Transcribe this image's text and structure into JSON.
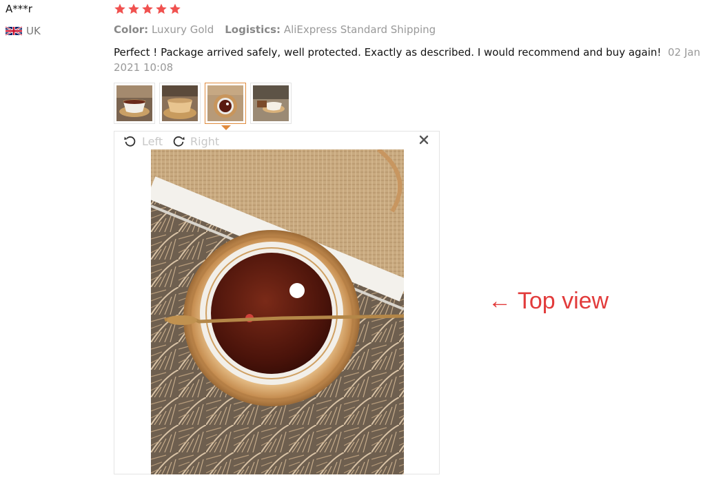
{
  "user": {
    "name": "A***r",
    "country": "UK",
    "flag_icon": "uk-flag-icon"
  },
  "review": {
    "rating": 5,
    "max_rating": 5,
    "star_color": "#f0514f",
    "color_label": "Color:",
    "color_value": "Luxury Gold",
    "logistics_label": "Logistics:",
    "logistics_value": "AliExpress Standard Shipping",
    "text": "Perfect ! Package arrived safely, well protected. Exactly as described. I would recommend and buy again!",
    "date": "02 Jan 2021 10:08"
  },
  "gallery": {
    "thumbnail_count": 4,
    "active_index": 2,
    "accent_color": "#e08a3c"
  },
  "viewer": {
    "rotate_left_label": "Left",
    "rotate_right_label": "Right",
    "close_icon": "close-icon"
  },
  "annotation": {
    "text": "← Top view",
    "color": "#e23b3b"
  }
}
